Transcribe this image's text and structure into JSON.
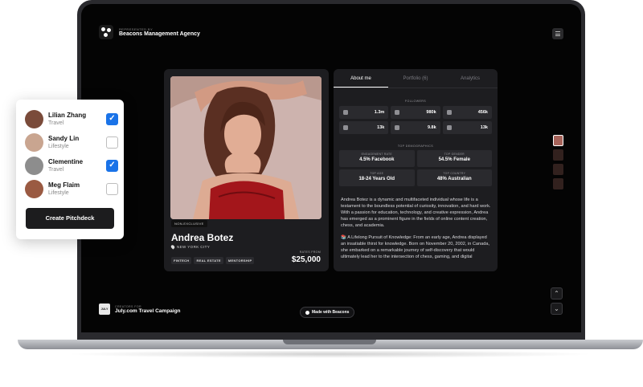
{
  "agency": {
    "kicker": "REPRESENTED BY",
    "name": "Beacons Management Agency"
  },
  "profile": {
    "badge": "NON-EXCLUSIVE",
    "name": "Andrea Botez",
    "city": "NEW YORK CITY",
    "tags": [
      "FINTECH",
      "REAL ESTATE",
      "MENTORSHIP"
    ],
    "rates_label": "RATES FROM",
    "rates_value": "$25,000"
  },
  "tabs": [
    {
      "label": "About me",
      "active": true
    },
    {
      "label": "Portfolio (6)",
      "active": false
    },
    {
      "label": "Analytics",
      "active": false
    }
  ],
  "followers": {
    "title": "FOLLOWERS",
    "items": [
      {
        "icon": "tiktok-icon",
        "value": "1.3m"
      },
      {
        "icon": "instagram-icon",
        "value": "980k"
      },
      {
        "icon": "youtube-icon",
        "value": "456k"
      },
      {
        "icon": "twitch-icon",
        "value": "13k"
      },
      {
        "icon": "twitter-icon",
        "value": "9.8k"
      },
      {
        "icon": "twitch-icon",
        "value": "13k"
      }
    ]
  },
  "demographics": {
    "title": "TOP DEMOGRAPHICS",
    "items": [
      {
        "label": "ENGAGEMENT RATE",
        "value": "4.5% Facebook"
      },
      {
        "label": "TOP GENDER",
        "value": "54.5% Female"
      },
      {
        "label": "TOP AGE",
        "value": "18-24 Years Old"
      },
      {
        "label": "TOP COUNTRY",
        "value": "48% Australian"
      }
    ]
  },
  "bio": {
    "p1": "Andrea Botez is a dynamic and multifaceted individual whose life is a testament to the boundless potential of curiosity, innovation, and hard work. With a passion for education, technology, and creative expression, Andrea has emerged as a prominent figure in the fields of online content creation, chess, and academia.",
    "p2": "📚 A Lifelong Pursuit of Knowledge: From an early age, Andrea displayed an insatiable thirst for knowledge. Born on November 20, 2002, in Canada, she embarked on a remarkable journey of self-discovery that would ultimately lead her to the intersection of chess, gaming, and digital"
  },
  "footer": {
    "kicker": "CREATORS FOR",
    "logo_text": "JULY",
    "campaign": "July.com Travel Campaign",
    "made_with": "Made with Beacons"
  },
  "pitchdeck": {
    "people": [
      {
        "name": "Lilian Zhang",
        "category": "Travel",
        "checked": true
      },
      {
        "name": "Sandy Lin",
        "category": "Lifestyle",
        "checked": false
      },
      {
        "name": "Clementine",
        "category": "Travel",
        "checked": true
      },
      {
        "name": "Meg Flaim",
        "category": "Lifestyle",
        "checked": false
      }
    ],
    "button": "Create Pitchdeck"
  },
  "colors": {
    "checkbox_on": "#1a73e8",
    "screen_bg": "#040404",
    "card_bg": "#1d1d20"
  }
}
